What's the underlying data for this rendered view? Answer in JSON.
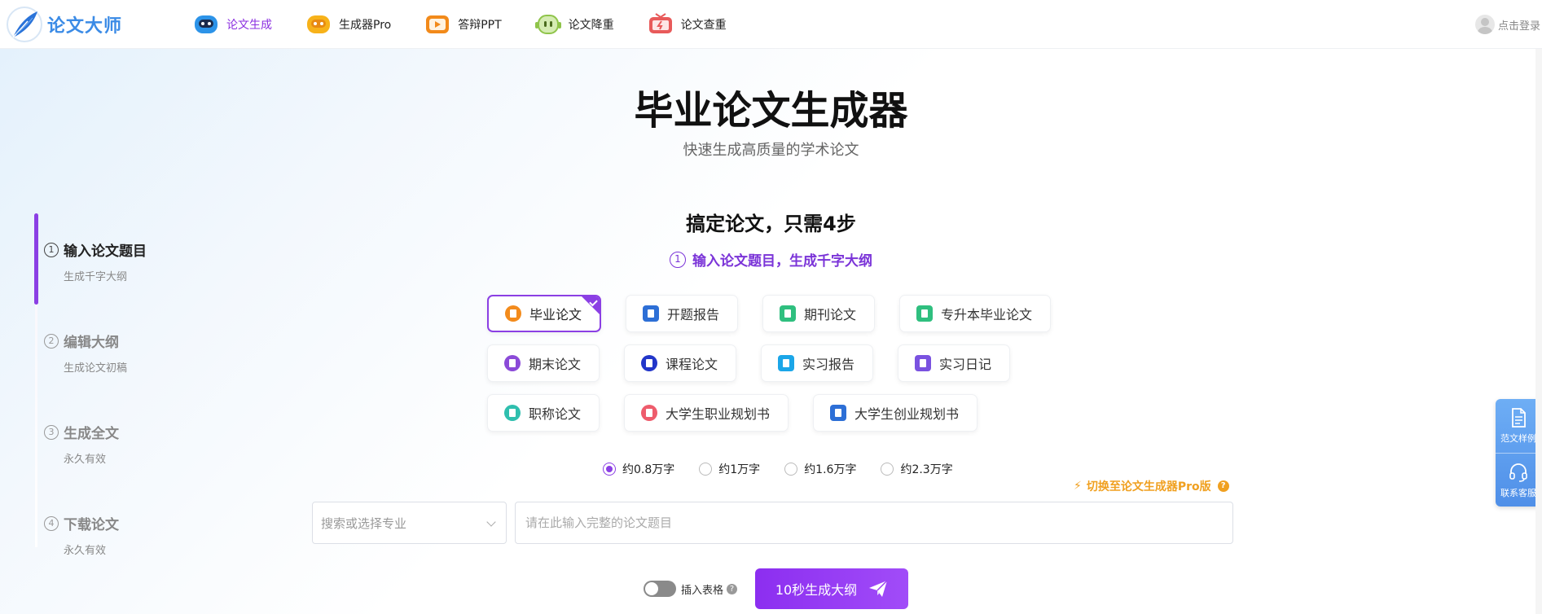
{
  "brand": {
    "name": "论文大师"
  },
  "nav": [
    {
      "label": "论文生成",
      "active": true,
      "icon": "robot-icon",
      "color": "#2c93e8"
    },
    {
      "label": "生成器Pro",
      "active": false,
      "icon": "robot-pro-icon",
      "color": "#f7b21a"
    },
    {
      "label": "答辩PPT",
      "active": false,
      "icon": "play-tv-icon",
      "color": "#f28a1a"
    },
    {
      "label": "论文降重",
      "active": false,
      "icon": "green-robot-icon",
      "color": "#8fc44a"
    },
    {
      "label": "论文查重",
      "active": false,
      "icon": "tv-check-icon",
      "color": "#e85a5a"
    }
  ],
  "login": {
    "label": "点击登录"
  },
  "hero": {
    "title": "毕业论文生成器",
    "subtitle": "快速生成高质量的学术论文"
  },
  "steps": [
    {
      "num": "1",
      "title": "输入论文题目",
      "sub": "生成千字大纲",
      "active": true
    },
    {
      "num": "2",
      "title": "编辑大纲",
      "sub": "生成论文初稿",
      "active": false
    },
    {
      "num": "3",
      "title": "生成全文",
      "sub": "永久有效",
      "active": false
    },
    {
      "num": "4",
      "title": "下载论文",
      "sub": "永久有效",
      "active": false
    }
  ],
  "section": {
    "title": "搞定论文，只需4步",
    "step_num": "1",
    "step_text": "输入论文题目，生成千字大纲"
  },
  "paper_types": [
    [
      {
        "label": "毕业论文",
        "color": "#f38b1c",
        "selected": true
      },
      {
        "label": "开题报告",
        "color": "#2d6fd6",
        "selected": false
      },
      {
        "label": "期刊论文",
        "color": "#2fbf7f",
        "selected": false
      },
      {
        "label": "专升本毕业论文",
        "color": "#2fbf7f",
        "selected": false
      }
    ],
    [
      {
        "label": "期末论文",
        "color": "#8b4ad8",
        "selected": false
      },
      {
        "label": "课程论文",
        "color": "#2236c9",
        "selected": false
      },
      {
        "label": "实习报告",
        "color": "#1ba6e8",
        "selected": false
      },
      {
        "label": "实习日记",
        "color": "#7a52e0",
        "selected": false
      }
    ],
    [
      {
        "label": "职称论文",
        "color": "#2fbfae",
        "selected": false
      },
      {
        "label": "大学生职业规划书",
        "color": "#ee5c6c",
        "selected": false
      },
      {
        "label": "大学生创业规划书",
        "color": "#2d6fd6",
        "selected": false
      }
    ]
  ],
  "word_counts": [
    {
      "label": "约0.8万字",
      "checked": true
    },
    {
      "label": "约1万字",
      "checked": false
    },
    {
      "label": "约1.6万字",
      "checked": false
    },
    {
      "label": "约2.3万字",
      "checked": false
    }
  ],
  "pro_switch": {
    "label": "切换至论文生成器Pro版"
  },
  "major": {
    "placeholder": "搜索或选择专业"
  },
  "title_input": {
    "placeholder": "请在此输入完整的论文题目",
    "value": ""
  },
  "insert_table": {
    "label": "插入表格",
    "on": false
  },
  "generate": {
    "label": "10秒生成大纲"
  },
  "float": [
    {
      "label": "范文样例",
      "icon": "document-icon"
    },
    {
      "label": "联系客服",
      "icon": "headset-icon"
    }
  ],
  "colors": {
    "accent": "#8b3fe4",
    "brand": "#3b8be6",
    "warning": "#f0a020"
  }
}
